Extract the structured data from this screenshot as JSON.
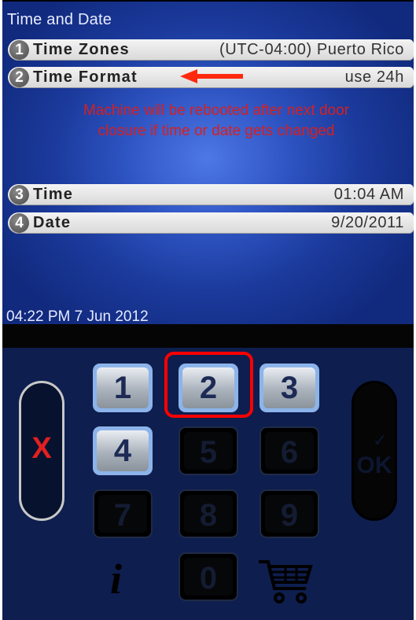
{
  "screen": {
    "title": "Time and Date",
    "items": [
      {
        "num": "1",
        "label": "Time Zones",
        "value": "(UTC-04:00) Puerto Rico"
      },
      {
        "num": "2",
        "label": "Time Format",
        "value": "use 24h"
      },
      {
        "num": "3",
        "label": "Time",
        "value": "01:04 AM"
      },
      {
        "num": "4",
        "label": "Date",
        "value": "9/20/2011"
      }
    ],
    "warning_line1": "Machine will be rebooted after next door",
    "warning_line2": "closure if time or date gets changed",
    "status_clock": "04:22 PM 7 Jun 2012"
  },
  "keypad": {
    "keys": [
      "1",
      "2",
      "3",
      "4",
      "5",
      "6",
      "7",
      "8",
      "9",
      "0"
    ],
    "cancel_label": "X",
    "ok_label": "OK",
    "ok_check": "✓",
    "info_label": "i"
  },
  "annotations": {
    "arrow_color": "#ff2a0e",
    "highlight_color": "#ff0000"
  }
}
